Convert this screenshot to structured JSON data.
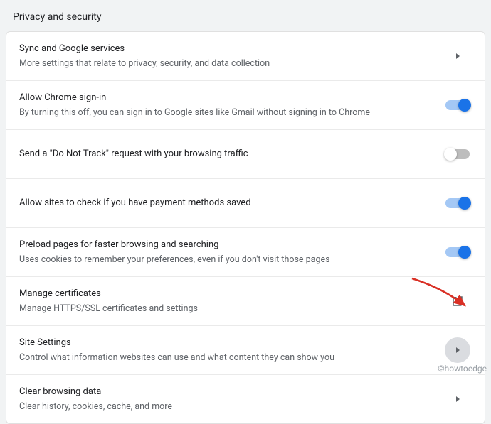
{
  "header": {
    "title": "Privacy and security"
  },
  "rows": {
    "sync": {
      "title": "Sync and Google services",
      "sub": "More settings that relate to privacy, security, and data collection"
    },
    "signin": {
      "title": "Allow Chrome sign-in",
      "sub": "By turning this off, you can sign in to Google sites like Gmail without signing in to Chrome"
    },
    "dnt": {
      "title": "Send a \"Do Not Track\" request with your browsing traffic"
    },
    "payment": {
      "title": "Allow sites to check if you have payment methods saved"
    },
    "preload": {
      "title": "Preload pages for faster browsing and searching",
      "sub": "Uses cookies to remember your preferences, even if you don't visit those pages"
    },
    "certs": {
      "title": "Manage certificates",
      "sub": "Manage HTTPS/SSL certificates and settings"
    },
    "site": {
      "title": "Site Settings",
      "sub": "Control what information websites can use and what content they can show you"
    },
    "clear": {
      "title": "Clear browsing data",
      "sub": "Clear history, cookies, cache, and more"
    }
  },
  "toggles": {
    "signin": true,
    "dnt": false,
    "payment": true,
    "preload": true
  },
  "watermark": "©howtoedge"
}
